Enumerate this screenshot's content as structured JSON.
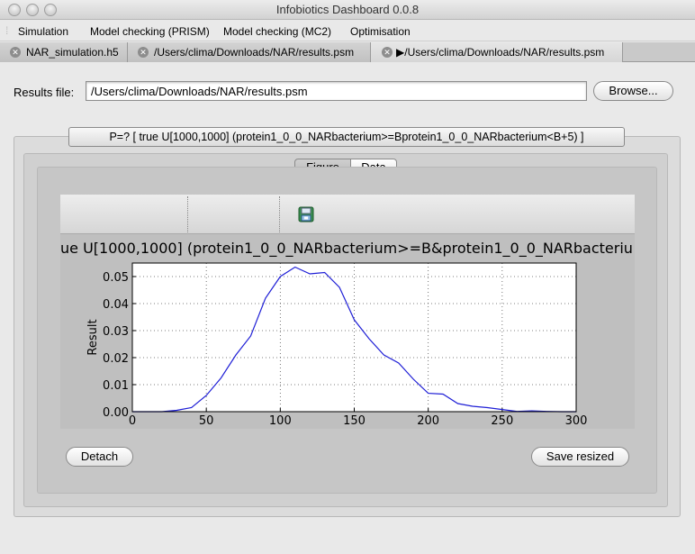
{
  "window": {
    "title": "Infobiotics Dashboard 0.0.8"
  },
  "menubar": {
    "items": [
      "Simulation",
      "Model checking (PRISM)",
      "Model checking (MC2)",
      "Optimisation"
    ]
  },
  "tabs": [
    {
      "label": "NAR_simulation.h5",
      "active": false
    },
    {
      "label": "/Users/clima/Downloads/NAR/results.psm",
      "active": false
    },
    {
      "label": "▶/Users/clima/Downloads/NAR/results.psm",
      "active": true
    }
  ],
  "results": {
    "label": "Results file:",
    "value": "/Users/clima/Downloads/NAR/results.psm",
    "browse_label": "Browse..."
  },
  "property": {
    "text": "P=? [ true U[1000,1000] (protein1_0_0_NARbacterium>=Bprotein1_0_0_NARbacterium<B+5) ]"
  },
  "view_toggle": {
    "figure_label": "Figure",
    "data_label": "Data",
    "selected": "Figure"
  },
  "toolbar": {
    "icon": "save-figure-icon"
  },
  "buttons": {
    "detach_label": "Detach",
    "save_resized_label": "Save resized"
  },
  "colors": {
    "line": "#1f1fd6"
  },
  "chart_data": {
    "type": "line",
    "title": "ue U[1000,1000] (protein1_0_0_NARbacterium>=B&protein1_0_0_NARbacteriu",
    "xlabel": "",
    "ylabel": "Result",
    "xlim": [
      0,
      300
    ],
    "ylim": [
      0,
      0.055
    ],
    "xticks": [
      "0",
      "50",
      "100",
      "150",
      "200",
      "250",
      "300"
    ],
    "yticks": [
      "0.00",
      "0.01",
      "0.02",
      "0.03",
      "0.04",
      "0.05"
    ],
    "grid": true,
    "series": [
      {
        "x": [
          0,
          10,
          20,
          30,
          40,
          50,
          60,
          70,
          80,
          90,
          100,
          110,
          120,
          130,
          140,
          150,
          160,
          170,
          180,
          190,
          200,
          210,
          220,
          230,
          240,
          250,
          260,
          270,
          280,
          290,
          300
        ],
        "values": [
          0.0,
          0.0,
          0.0,
          0.0005,
          0.0015,
          0.006,
          0.0125,
          0.021,
          0.028,
          0.042,
          0.05,
          0.0535,
          0.051,
          0.0515,
          0.046,
          0.034,
          0.027,
          0.021,
          0.018,
          0.012,
          0.0068,
          0.0065,
          0.003,
          0.002,
          0.0015,
          0.0008,
          0.0001,
          0.0003,
          0.0001,
          0.0,
          0.0
        ]
      }
    ]
  }
}
